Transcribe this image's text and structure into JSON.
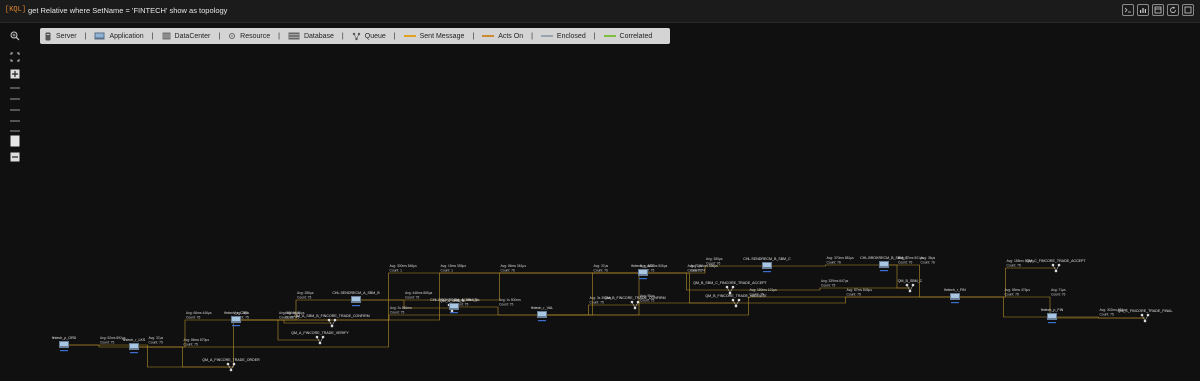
{
  "topbar": {
    "kql_badge": "[KQL]",
    "query": "get Relative where SetName = 'FINTECH' show as topology",
    "actions": [
      "terminal-icon",
      "chart-icon",
      "window-icon",
      "refresh-icon",
      "expand-icon"
    ]
  },
  "legend": {
    "items": [
      {
        "label": "Server",
        "icon": "server-icon"
      },
      {
        "label": "Application",
        "icon": "application-icon"
      },
      {
        "label": "DataCenter",
        "icon": "datacenter-icon"
      },
      {
        "label": "Resource",
        "icon": "resource-icon"
      },
      {
        "label": "Database",
        "icon": "database-icon"
      },
      {
        "label": "Queue",
        "icon": "queue-icon"
      },
      {
        "label": "Sent Message",
        "color": "#e0a020"
      },
      {
        "label": "Acts On",
        "color": "#d08a30"
      },
      {
        "label": "Enclosed",
        "color": "#9aa4ae"
      },
      {
        "label": "Correlated",
        "color": "#7fbf3f"
      }
    ]
  },
  "sidebar_tools": [
    "zoom-in-icon",
    "fit-screen-icon",
    "add-icon",
    "line-icon",
    "line-icon",
    "line-icon",
    "line-icon",
    "line-icon",
    "box-icon",
    "minus-icon"
  ],
  "nodes": [
    {
      "id": "n1",
      "label": "fintech_p_ORD",
      "type": "app"
    },
    {
      "id": "n2",
      "label": "fintech_r_LKS",
      "type": "app"
    },
    {
      "id": "n3",
      "label": "QM_A_FINCORE_TRADE_ORDER",
      "type": "queue"
    },
    {
      "id": "n4",
      "label": "fintech_r_CUS",
      "type": "app"
    },
    {
      "id": "n5",
      "label": "QM_A_FINCORE_TRADE_VERIFY",
      "type": "queue"
    },
    {
      "id": "n6",
      "label": "QM_A_SBM_B_FINCORE_TRADE_CONFIRM",
      "type": "queue"
    },
    {
      "id": "n7",
      "label": "CHL.SENDRECM_A_SBM_B",
      "type": "app"
    },
    {
      "id": "n8",
      "label": "QM_A_SBM_B",
      "type": "queue"
    },
    {
      "id": "n9",
      "label": "CHL.BROKRECM_A_SBM_B",
      "type": "app"
    },
    {
      "id": "n10",
      "label": "fintech_r_VAL",
      "type": "app"
    },
    {
      "id": "n11",
      "label": "QM_B_FINCORE_TRADE_CONFIRM",
      "type": "queue"
    },
    {
      "id": "n12",
      "label": "fintech_r_ACC",
      "type": "app"
    },
    {
      "id": "n13",
      "label": "QM_B_SBM_C_FINCORE_TRADE_ACCEPT",
      "type": "queue"
    },
    {
      "id": "n14",
      "label": "QM_B_FINCORE_TRADE_VALIDATE",
      "type": "queue"
    },
    {
      "id": "n15",
      "label": "CHL.SENDRECM_B_SBM_C",
      "type": "app"
    },
    {
      "id": "n16",
      "label": "CHL.BROKRECM_B_SBM_C",
      "type": "app"
    },
    {
      "id": "n17",
      "label": "QM_B_SBM_C",
      "type": "queue"
    },
    {
      "id": "n18",
      "label": "fintech_r_FIN",
      "type": "app"
    },
    {
      "id": "n19",
      "label": "QM_C_FINCORE_TRADE_ACCEPT",
      "type": "queue"
    },
    {
      "id": "n20",
      "label": "fintech_p_FIN",
      "type": "app"
    },
    {
      "id": "n21",
      "label": "QM_C_FINCORE_TRADE_FINAL",
      "type": "queue"
    }
  ],
  "edges": [
    {
      "from": "n1",
      "to": "n2",
      "avg": "Avg: 52ms 892µs",
      "count": "Count: 75"
    },
    {
      "from": "n2",
      "to": "n3",
      "avg": "Avg: 86ms 870µs",
      "count": "Count: 75"
    },
    {
      "from": "n1",
      "to": "n3",
      "avg": "Avg: 37µs",
      "count": "Count: 75"
    },
    {
      "from": "n2",
      "to": "n4",
      "avg": "Avg: 66ms 446µs",
      "count": "Count: 76"
    },
    {
      "from": "n4",
      "to": "n3",
      "avg": "Avg: 76µs",
      "count": "Count: 75"
    },
    {
      "from": "n4",
      "to": "n5",
      "avg": "Avg: 486ms 86µs",
      "count": "Count: 75"
    },
    {
      "from": "n4",
      "to": "n6",
      "avg": "Avg: 16µs",
      "count": "Count: 75"
    },
    {
      "from": "n4",
      "to": "n7",
      "avg": "Avg: 286µs",
      "count": "Count: 75"
    },
    {
      "from": "n7",
      "to": "n8",
      "avg": "Avg: 448ms 865µs",
      "count": "Count: 75"
    },
    {
      "from": "n8",
      "to": "n9",
      "avg": "Avg: 461ms 12µs",
      "count": "Count: 75"
    },
    {
      "from": "n9",
      "to": "n10",
      "avg": "Avg: 1s 500ms",
      "count": "Count: 75"
    },
    {
      "from": "n4",
      "to": "n10",
      "avg": "Avg: 2s 866ms",
      "count": "Count: 75"
    },
    {
      "from": "n10",
      "to": "n11",
      "avg": "Avg: 3s 300ms",
      "count": "Count: 75"
    },
    {
      "from": "n10",
      "to": "n12",
      "avg": "Avg: 37µs",
      "count": "Count: 76"
    },
    {
      "from": "n10",
      "to": "n14",
      "avg": "Avg: 90µs",
      "count": "Count: 75"
    },
    {
      "from": "n11",
      "to": "n12",
      "avg": "Avg: 180ms 806µs",
      "count": "Count: 75"
    },
    {
      "from": "n2",
      "to": "n12",
      "avg": "Avg: 300ms 846µs",
      "count": "Count: 1"
    },
    {
      "from": "n4",
      "to": "n12",
      "avg": "Avg: 15ms 355µs",
      "count": "Count: 1"
    },
    {
      "from": "n7",
      "to": "n12",
      "avg": "Avg: 86ms 361µs",
      "count": "Count: 76"
    },
    {
      "from": "n12",
      "to": "n15",
      "avg": "Avg: 355µs",
      "count": "Count: 76"
    },
    {
      "from": "n12",
      "to": "n13",
      "avg": "Avg: 71µs",
      "count": "Count: 76"
    },
    {
      "from": "n12",
      "to": "n14",
      "avg": "Avg: 304ms 396µs",
      "count": "Count: 74"
    },
    {
      "from": "n15",
      "to": "n16",
      "avg": "Avg: 370ms 881µs",
      "count": "Count: 76"
    },
    {
      "from": "n16",
      "to": "n17",
      "avg": "Avg: 87ms 501µs",
      "count": "Count: 76"
    },
    {
      "from": "n13",
      "to": "n17",
      "avg": "Avg: 339ms 647µs",
      "count": "Count: 75"
    },
    {
      "from": "n16",
      "to": "n18",
      "avg": "Avg: 36µs",
      "count": "Count: 76"
    },
    {
      "from": "n14",
      "to": "n18",
      "avg": "Avg: 87ms 846µs",
      "count": "Count: 75"
    },
    {
      "from": "n18",
      "to": "n19",
      "avg": "Avg: 188ms 834µs",
      "count": "Count: 75"
    },
    {
      "from": "n18",
      "to": "n20",
      "avg": "Avg: 85ms 476µs",
      "count": "Count: 75"
    },
    {
      "from": "n18",
      "to": "n21",
      "avg": "Avg: 71µs",
      "count": "Count: 75"
    },
    {
      "from": "n20",
      "to": "n21",
      "avg": "Avg: 302ms 681µs",
      "count": "Count: 75"
    },
    {
      "from": "n10",
      "to": "n18",
      "avg": "Avg: 180ms 121µs",
      "count": "Count: 75"
    }
  ]
}
